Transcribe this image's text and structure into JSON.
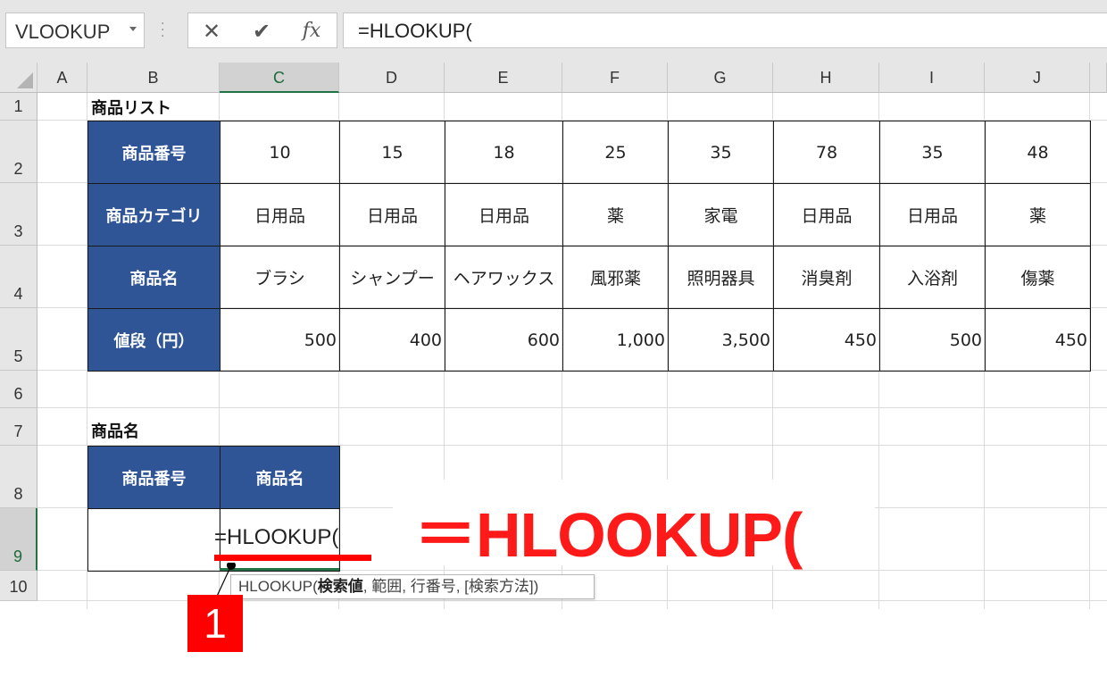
{
  "formula_bar": {
    "name_box": "VLOOKUP",
    "cancel_icon": "close-icon",
    "enter_icon": "check-icon",
    "fx_label": "fx",
    "formula": "=HLOOKUP("
  },
  "columns": [
    "A",
    "B",
    "C",
    "D",
    "E",
    "F",
    "G",
    "H",
    "I",
    "J"
  ],
  "selected_column": "C",
  "rows": [
    "1",
    "2",
    "3",
    "4",
    "5",
    "6",
    "7",
    "8",
    "9",
    "10"
  ],
  "selected_row": "9",
  "sheet": {
    "title1": "商品リスト",
    "table1": {
      "row_headers": [
        "商品番号",
        "商品カテゴリ",
        "商品名",
        "値段（円）"
      ],
      "rows": [
        [
          "10",
          "15",
          "18",
          "25",
          "35",
          "78",
          "35",
          "48"
        ],
        [
          "日用品",
          "日用品",
          "日用品",
          "薬",
          "家電",
          "日用品",
          "日用品",
          "薬"
        ],
        [
          "ブラシ",
          "シャンプー",
          "ヘアワックス",
          "風邪薬",
          "照明器具",
          "消臭剤",
          "入浴剤",
          "傷薬"
        ],
        [
          "500",
          "400",
          "600",
          "1,000",
          "3,500",
          "450",
          "500",
          "450"
        ]
      ]
    },
    "title2": "商品名",
    "table2": {
      "headers": [
        "商品番号",
        "商品名"
      ],
      "editing_text": "=HLOOKUP("
    }
  },
  "tooltip": {
    "func": "HLOOKUP(",
    "arg_bold": "検索値",
    "rest": ", 範囲, 行番号, [検索方法])"
  },
  "annotation": {
    "big_formula": "＝HLOOKUP(",
    "step_number": "1"
  },
  "colors": {
    "header_fill": "#2f5597",
    "accent_red": "#ff0000",
    "excel_green": "#217346"
  }
}
